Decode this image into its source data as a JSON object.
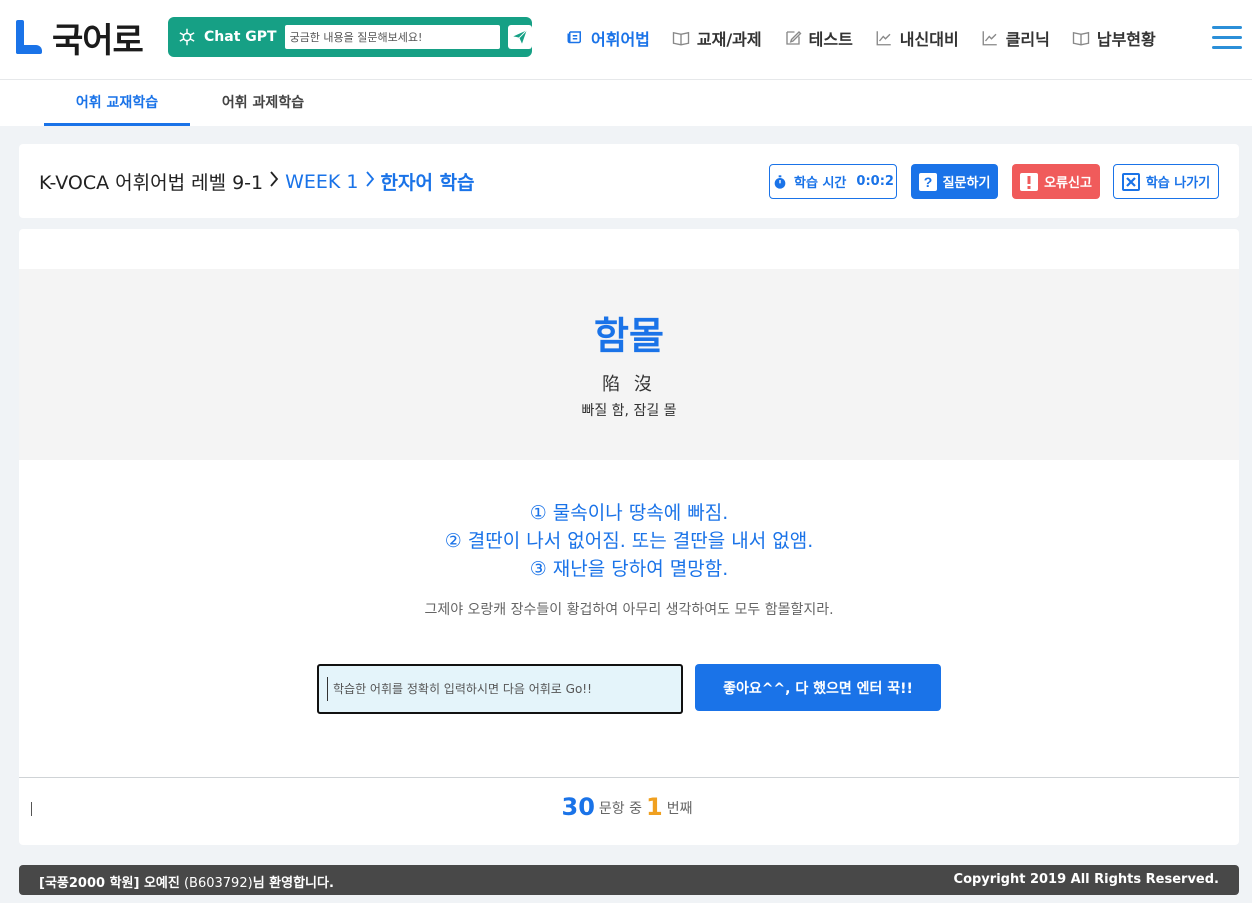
{
  "header": {
    "logo_text": "국어로",
    "gpt": {
      "label": "Chat GPT",
      "placeholder": "궁금한 내용을 질문해보세요!"
    },
    "nav": [
      {
        "label": "어휘어법",
        "icon": "scroll-icon",
        "active": true
      },
      {
        "label": "교재/과제",
        "icon": "book-icon",
        "active": false
      },
      {
        "label": "테스트",
        "icon": "edit-icon",
        "active": false
      },
      {
        "label": "내신대비",
        "icon": "chart-icon",
        "active": false
      },
      {
        "label": "클리닉",
        "icon": "chart-icon",
        "active": false
      },
      {
        "label": "납부현황",
        "icon": "book-icon",
        "active": false
      }
    ]
  },
  "subtabs": [
    {
      "label": "어휘 교재학습",
      "active": true
    },
    {
      "label": "어휘 과제학습",
      "active": false
    }
  ],
  "breadcrumb": {
    "level": "K-VOCA 어휘어법 레벨 9-1",
    "week": "WEEK 1",
    "section": "한자어 학습"
  },
  "toolbar": {
    "timer_label": "학습 시간",
    "timer_value": "0:0:2",
    "question_label": "질문하기",
    "error_label": "오류신고",
    "exit_label": "학습 나가기"
  },
  "word": {
    "term": "함몰",
    "hanja": "陷 沒",
    "hanja_meaning": "빠질 함, 잠길 몰",
    "meanings": [
      "① 물속이나 땅속에 빠짐.",
      "② 결딴이 나서 없어짐. 또는 결딴을 내서 없앰.",
      "③ 재난을 당하여 멸망함."
    ],
    "example": "그제야 오랑캐 장수들이 황겁하여 아무리 생각하여도 모두 함몰할지라."
  },
  "answer": {
    "placeholder": "학습한 어휘를 정확히 입력하시면 다음 어휘로 Go!!",
    "submit_label": "좋아요^^, 다 했으면 엔터 꾹!!"
  },
  "progress": {
    "total": "30",
    "mid_text": "문항 중",
    "current": "1",
    "suffix": "번째"
  },
  "footer": {
    "academy": "[국풍2000 학원] 오예진",
    "user_id": "(B603792)",
    "welcome": "님 환영합니다.",
    "copyright": "Copyright 2019 All Rights Reserved."
  },
  "colors": {
    "accent": "#1a73e8",
    "gpt_green": "#16a085",
    "error_red": "#f05b5b",
    "progress_orange": "#f0a020",
    "footer_bg": "#484848"
  }
}
